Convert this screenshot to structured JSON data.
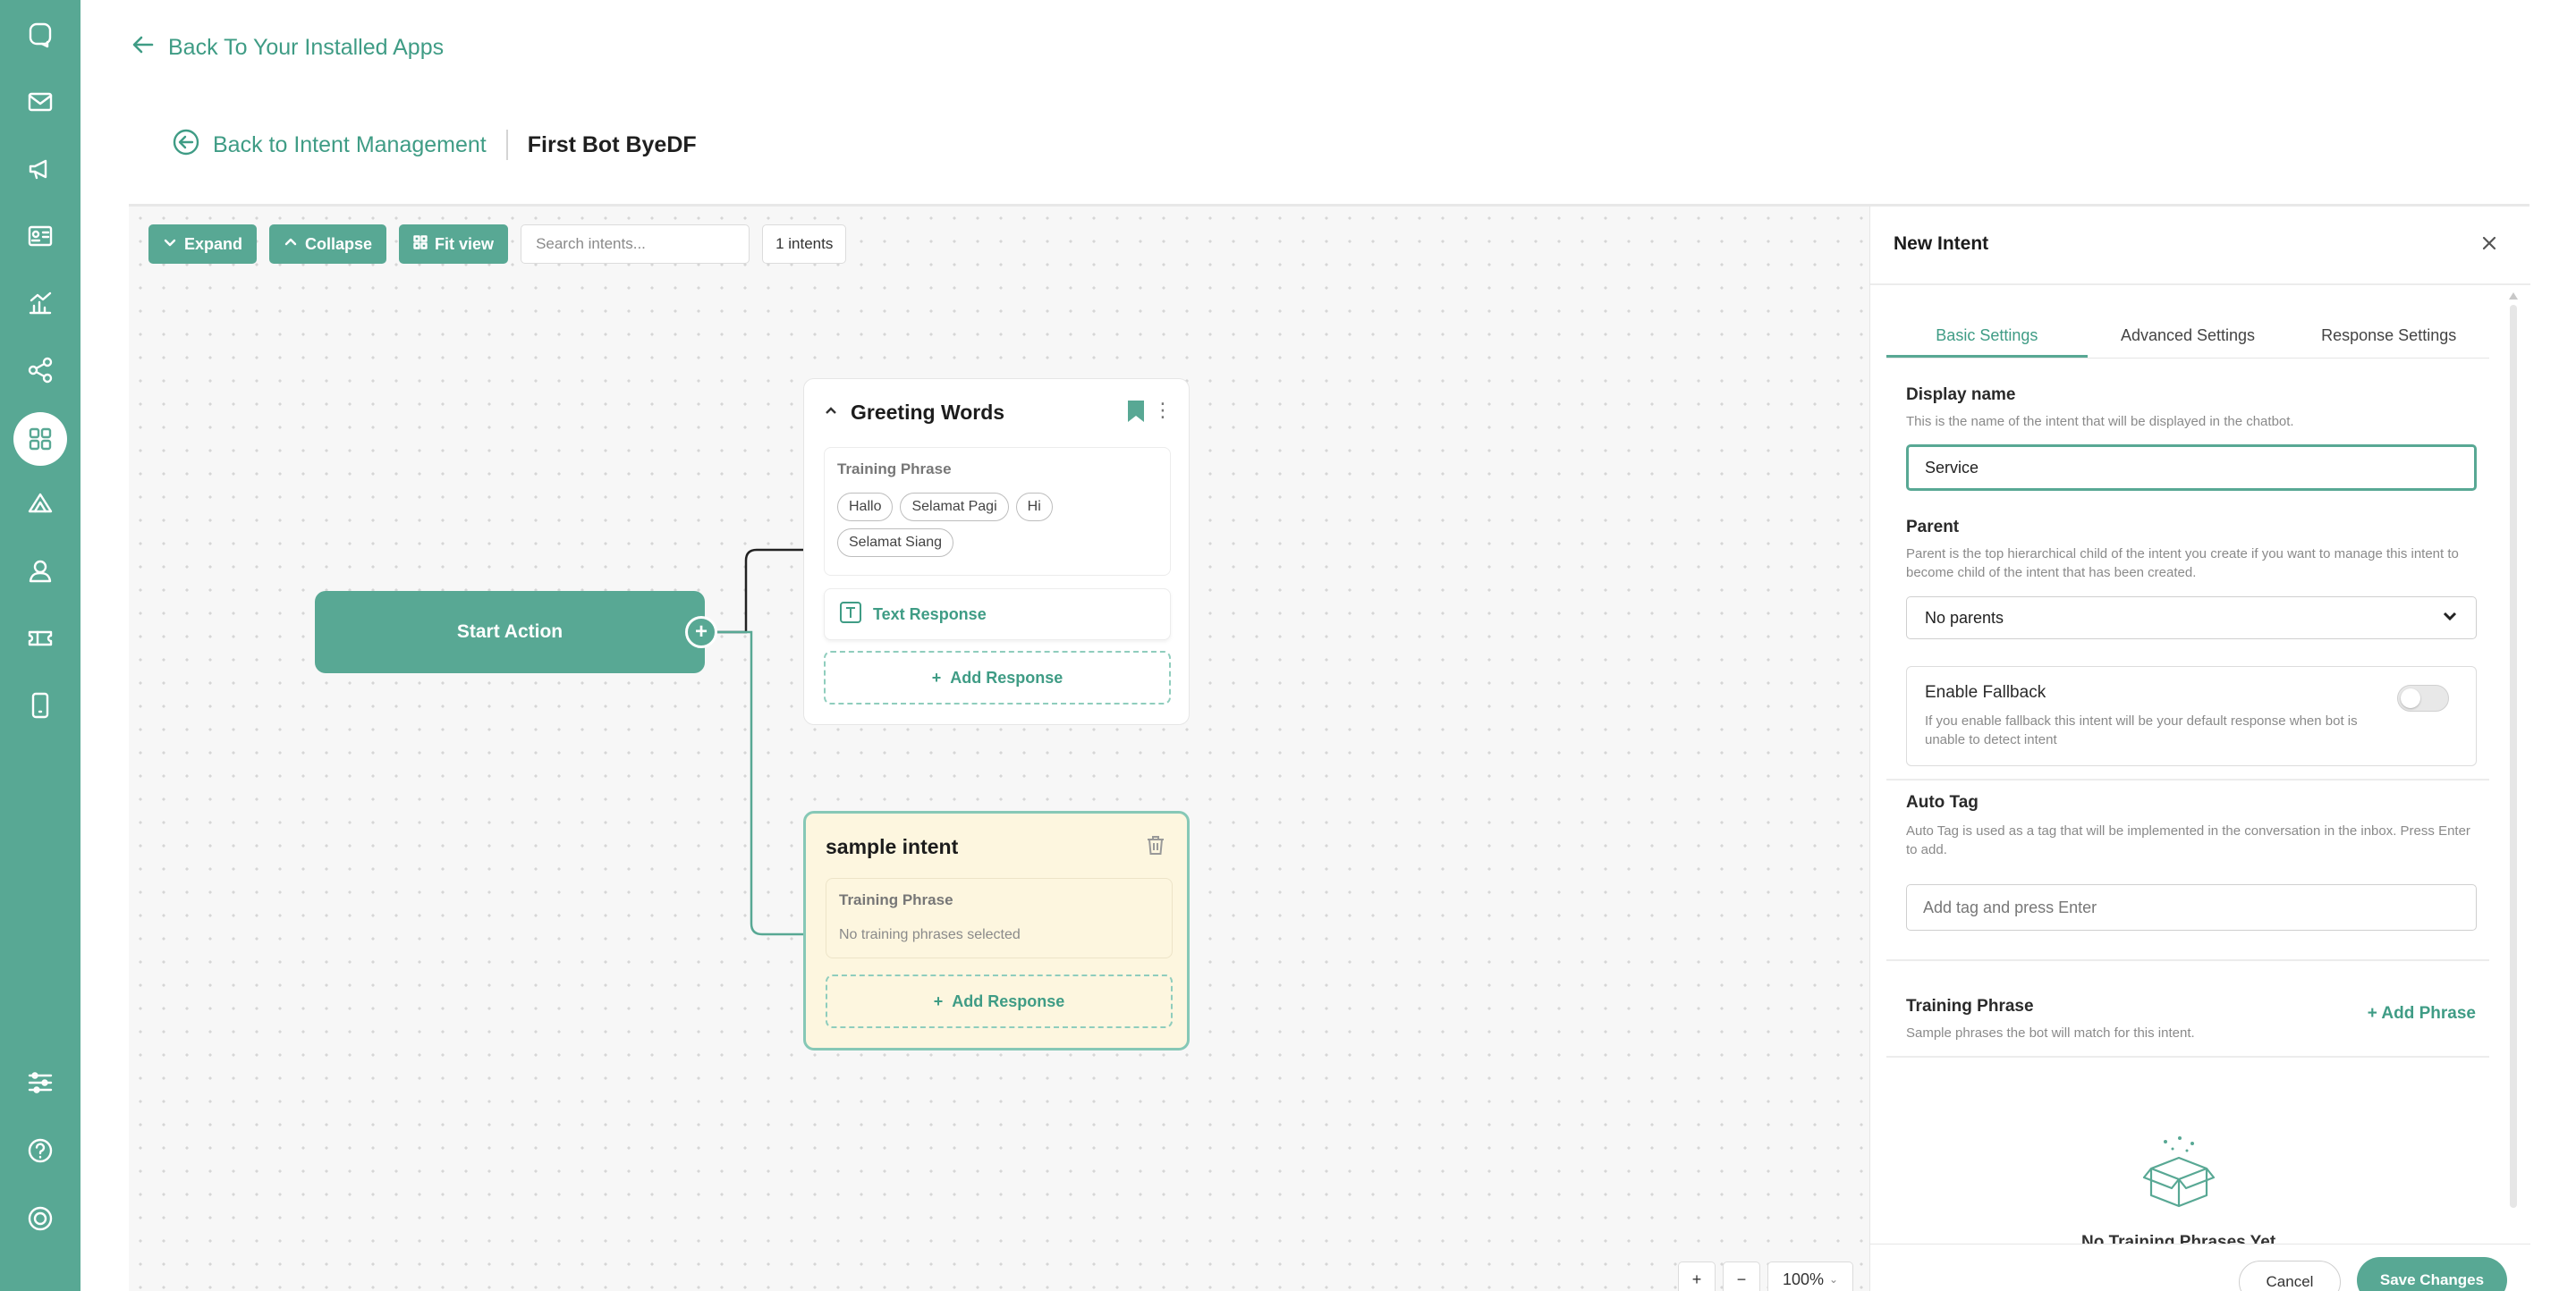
{
  "header": {
    "back_apps_label": "Back To Your Installed Apps",
    "back_intent_label": "Back to Intent Management",
    "bot_name": "First Bot ByeDF"
  },
  "sidebar": {
    "icons": [
      "chat-icon",
      "mail-icon",
      "megaphone-icon",
      "contact-card-icon",
      "analytics-icon",
      "share-flow-icon",
      "apps-grid-icon",
      "omnichannel-icon",
      "user-icon",
      "ticket-icon",
      "mobile-icon",
      "settings-sliders-icon",
      "help-icon",
      "power-icon"
    ],
    "active": "apps-grid-icon"
  },
  "toolbar": {
    "expand_label": "Expand",
    "collapse_label": "Collapse",
    "fit_label": "Fit view",
    "search_placeholder": "Search intents...",
    "count_label": "1 intents"
  },
  "flow": {
    "start_label": "Start Action",
    "greeting": {
      "title": "Greeting Words",
      "phrase_label": "Training Phrase",
      "phrases": [
        "Hallo",
        "Selamat Pagi",
        "Hi",
        "Selamat Siang"
      ],
      "response_label": "Text Response",
      "add_response_label": "Add Response"
    },
    "sample": {
      "title": "sample intent",
      "phrase_label": "Training Phrase",
      "no_phrase_text": "No training phrases selected",
      "add_response_label": "Add Response"
    }
  },
  "zoom": {
    "plus": "+",
    "minus": "−",
    "level": "100%"
  },
  "panel": {
    "title": "New Intent",
    "tabs": [
      "Basic Settings",
      "Advanced Settings",
      "Response Settings"
    ],
    "active_tab": "Basic Settings",
    "display_name": {
      "label": "Display name",
      "help": "This is the name of the intent that will be displayed in the chatbot.",
      "value": "Service"
    },
    "parent": {
      "label": "Parent",
      "help": "Parent is the top hierarchical child of the intent you create if you want to manage this intent to become child of the intent that has been created.",
      "value": "No parents"
    },
    "fallback": {
      "label": "Enable Fallback",
      "help": "If you enable fallback this intent will be your default response when bot is unable to detect intent",
      "enabled": false
    },
    "auto_tag": {
      "label": "Auto Tag",
      "help": "Auto Tag is used as a tag that will be implemented in the conversation in the inbox. Press Enter to add.",
      "placeholder": "Add tag and press Enter"
    },
    "training": {
      "label": "Training Phrase",
      "help": "Sample phrases the bot will match for this intent.",
      "add_label": "+ Add Phrase",
      "empty_text": "No Training Phrases Yet"
    },
    "cancel_label": "Cancel",
    "save_label": "Save Changes"
  },
  "colors": {
    "brand": "#58a894",
    "brand_text": "#3f9c85",
    "sample_card_bg": "#fdf6df"
  }
}
